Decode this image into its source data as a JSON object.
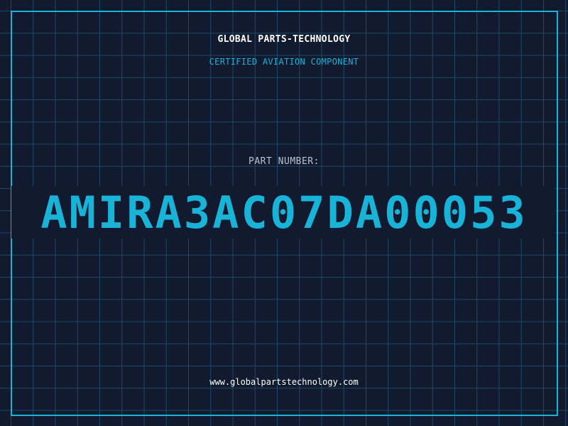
{
  "header": {
    "company": "GLOBAL PARTS-TECHNOLOGY",
    "subtitle": "CERTIFIED AVIATION COMPONENT"
  },
  "part": {
    "label": "PART NUMBER:",
    "number": "AMIRA3AC07DA00053"
  },
  "footer": {
    "url": "www.globalpartstechnology.com"
  },
  "colors": {
    "background": "#111a2e",
    "grid": "#1c4a66",
    "accent": "#1ab3d8",
    "title": "#ffffff",
    "label": "#b8c2cf"
  }
}
